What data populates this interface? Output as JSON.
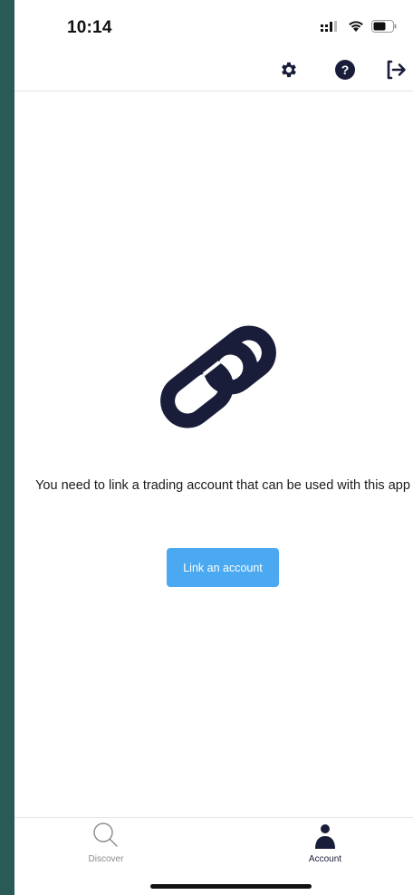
{
  "status_bar": {
    "time": "10:14"
  },
  "header": {
    "icons": [
      "gear-icon",
      "help-icon",
      "logout-icon"
    ]
  },
  "main": {
    "graphic": "chain-link-icon",
    "message": "You need to link a trading account that can be used with this app",
    "button_label": "Link an account"
  },
  "tab_bar": {
    "tabs": [
      {
        "label": "Discover",
        "icon": "search-icon",
        "active": false
      },
      {
        "label": "Account",
        "icon": "person-icon",
        "active": true
      }
    ]
  },
  "colors": {
    "accent": "#4aa9f0",
    "icon_dark": "#1a1d3a",
    "tab_inactive": "#8a8a8a",
    "tab_active": "#1a1d3a"
  }
}
